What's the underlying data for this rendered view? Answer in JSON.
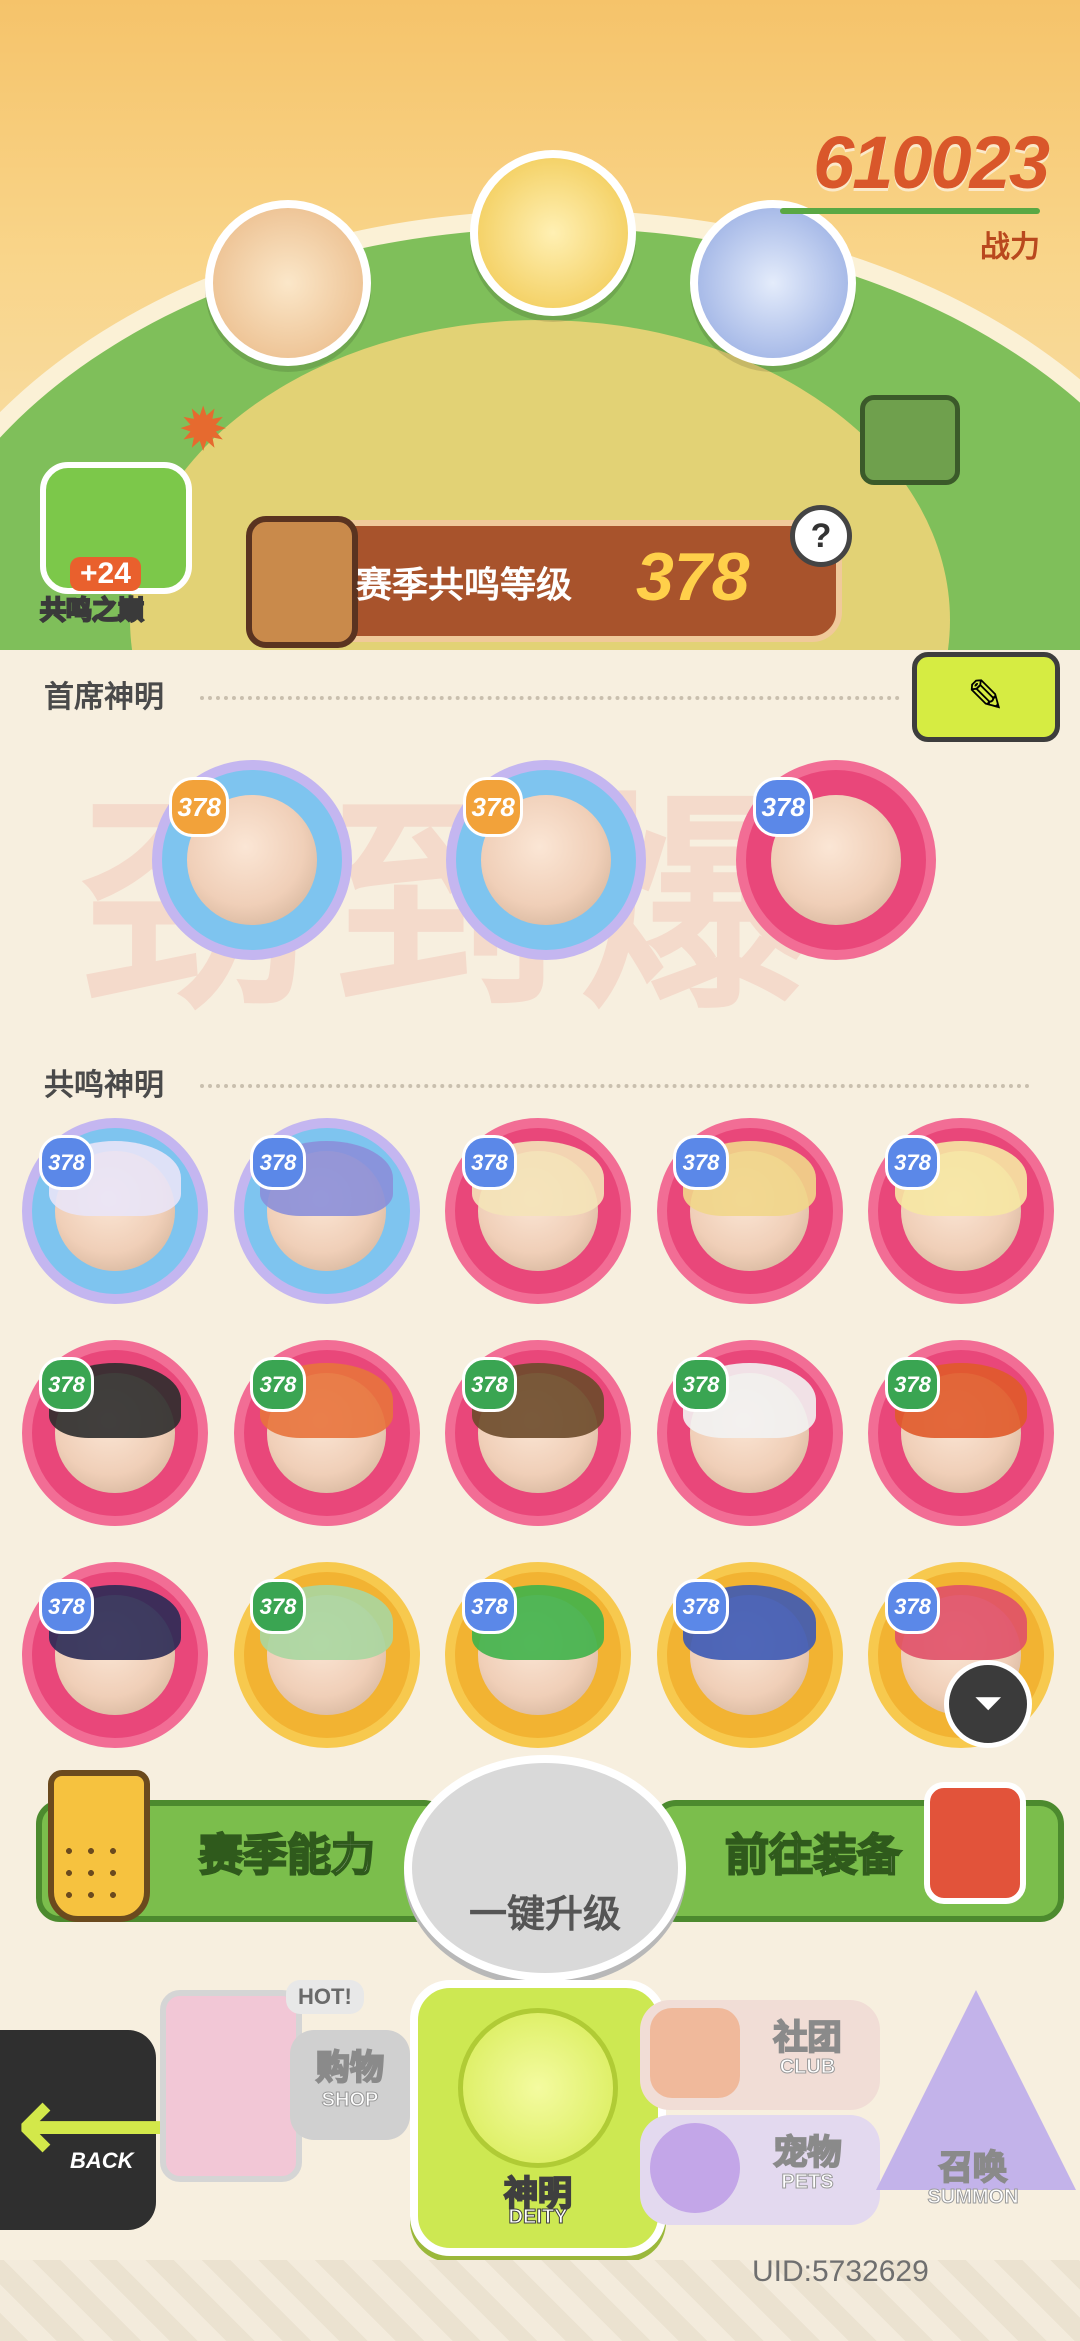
{
  "power": {
    "value": "610023",
    "label": "战力"
  },
  "resonance_badge": {
    "bonus": "+24",
    "name": "共鸣之巅"
  },
  "season_bar": {
    "label": "赛季共鸣等级",
    "level": "378",
    "help": "?"
  },
  "sections": {
    "chief": "首席神明",
    "resonance": "共鸣神明"
  },
  "watermark": "劲到爆",
  "chief_deities": [
    {
      "level": "378",
      "rarity": "blue"
    },
    {
      "level": "378",
      "rarity": "blue"
    },
    {
      "level": "378",
      "rarity": "pink"
    }
  ],
  "resonance_deities": [
    {
      "level": "378",
      "rarity": "blue"
    },
    {
      "level": "378",
      "rarity": "blue"
    },
    {
      "level": "378",
      "rarity": "pink"
    },
    {
      "level": "378",
      "rarity": "pink"
    },
    {
      "level": "378",
      "rarity": "pink"
    },
    {
      "level": "378",
      "rarity": "pink"
    },
    {
      "level": "378",
      "rarity": "pink"
    },
    {
      "level": "378",
      "rarity": "pink"
    },
    {
      "level": "378",
      "rarity": "pink"
    },
    {
      "level": "378",
      "rarity": "pink"
    },
    {
      "level": "378",
      "rarity": "pink"
    },
    {
      "level": "378",
      "rarity": "gold"
    },
    {
      "level": "378",
      "rarity": "gold"
    },
    {
      "level": "378",
      "rarity": "gold"
    },
    {
      "level": "378",
      "rarity": "gold"
    }
  ],
  "actions": {
    "season_ability": "赛季能力",
    "one_click_upgrade": "一键升级",
    "go_equip": "前往装备"
  },
  "nav": {
    "back": "BACK",
    "shop_cn": "购物",
    "shop_en": "SHOP",
    "hot": "HOT!",
    "deity_cn": "神明",
    "deity_en": "DEITY",
    "club_cn": "社团",
    "club_en": "CLUB",
    "pets_cn": "宠物",
    "pets_en": "PETS",
    "summon_cn": "召唤",
    "summon_en": "SUMMON"
  },
  "uid": "UID:5732629",
  "colors": {
    "accent": "#d9572a",
    "green": "#7bbe4c",
    "pink": "#e9477a",
    "gold": "#f2b332",
    "blue": "#7ec4ef"
  }
}
